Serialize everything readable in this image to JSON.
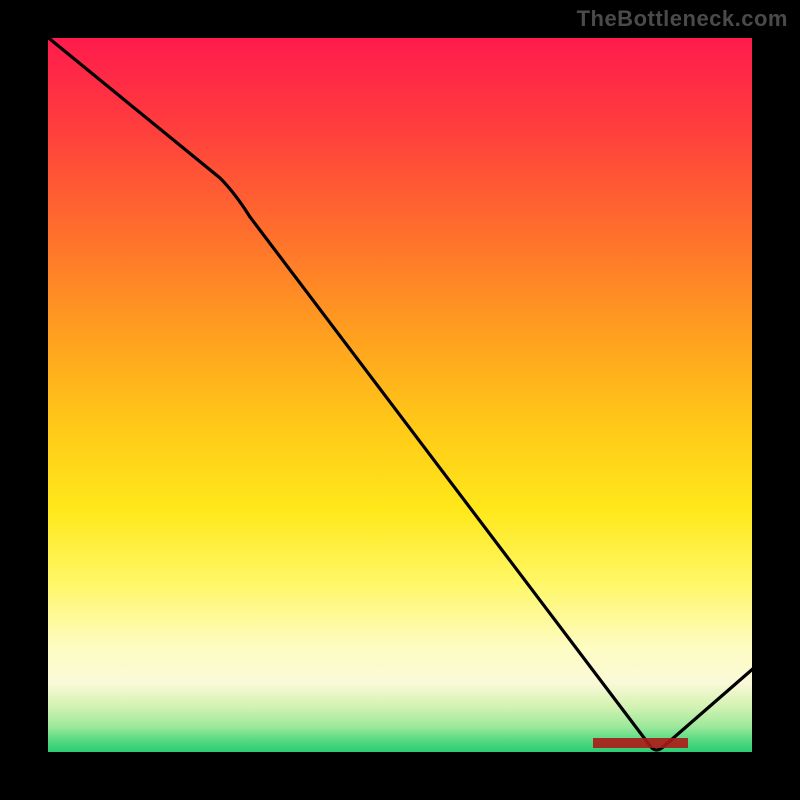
{
  "watermark": "TheBottleneck.com",
  "chart_data": {
    "type": "line",
    "title": "",
    "xlabel": "",
    "ylabel": "",
    "x": [
      0.0,
      0.25,
      0.86,
      1.0
    ],
    "values": [
      1.0,
      0.8,
      0.0,
      0.12
    ],
    "xlim": [
      0,
      1
    ],
    "ylim": [
      0,
      1
    ],
    "minimum_region": [
      0.78,
      0.9
    ],
    "background_gradient": {
      "type": "vertical",
      "stops": [
        {
          "pos": 0.0,
          "color": "#ff1a4d"
        },
        {
          "pos": 0.5,
          "color": "#ffc818"
        },
        {
          "pos": 0.85,
          "color": "#fdfcc2"
        },
        {
          "pos": 1.0,
          "color": "#1fc96e"
        }
      ]
    },
    "annotations": [
      {
        "text": "",
        "x": 0.83,
        "y": 0.01
      }
    ]
  },
  "labels": {
    "curve_marker": ""
  }
}
